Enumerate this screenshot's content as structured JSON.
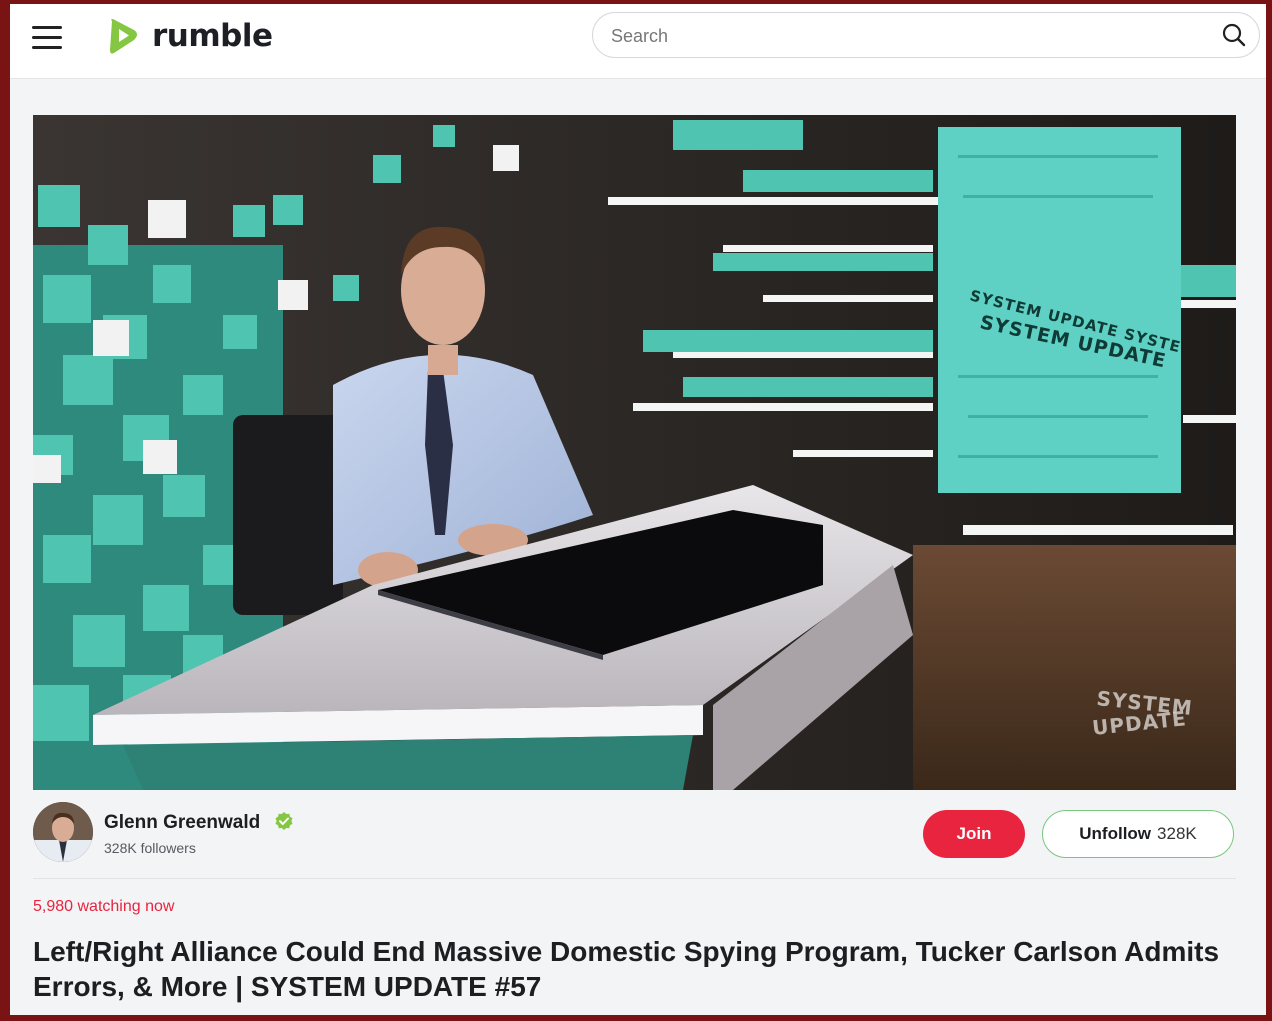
{
  "header": {
    "logo_text": "rumble",
    "search_placeholder": "Search"
  },
  "video": {
    "overlay_text_screen_1": "SYSTEM UPDATE SYSTE",
    "overlay_text_screen_2": "SYSTEM UPDATE",
    "watermark_line1": "SYSTEM",
    "watermark_line2": "UPDATE"
  },
  "channel": {
    "name": "Glenn Greenwald",
    "followers": "328K followers",
    "join_label": "Join",
    "unfollow_label": "Unfollow",
    "unfollow_count": "328K"
  },
  "watching": "5,980 watching now",
  "title": "Left/Right Alliance Could End Massive Domestic Spying Program, Tucker Carlson Admits Errors, & More | SYSTEM UPDATE #57",
  "colors": {
    "brand_green": "#85c742",
    "join_red": "#e8243f",
    "teal_accent": "#3bb3a0"
  }
}
